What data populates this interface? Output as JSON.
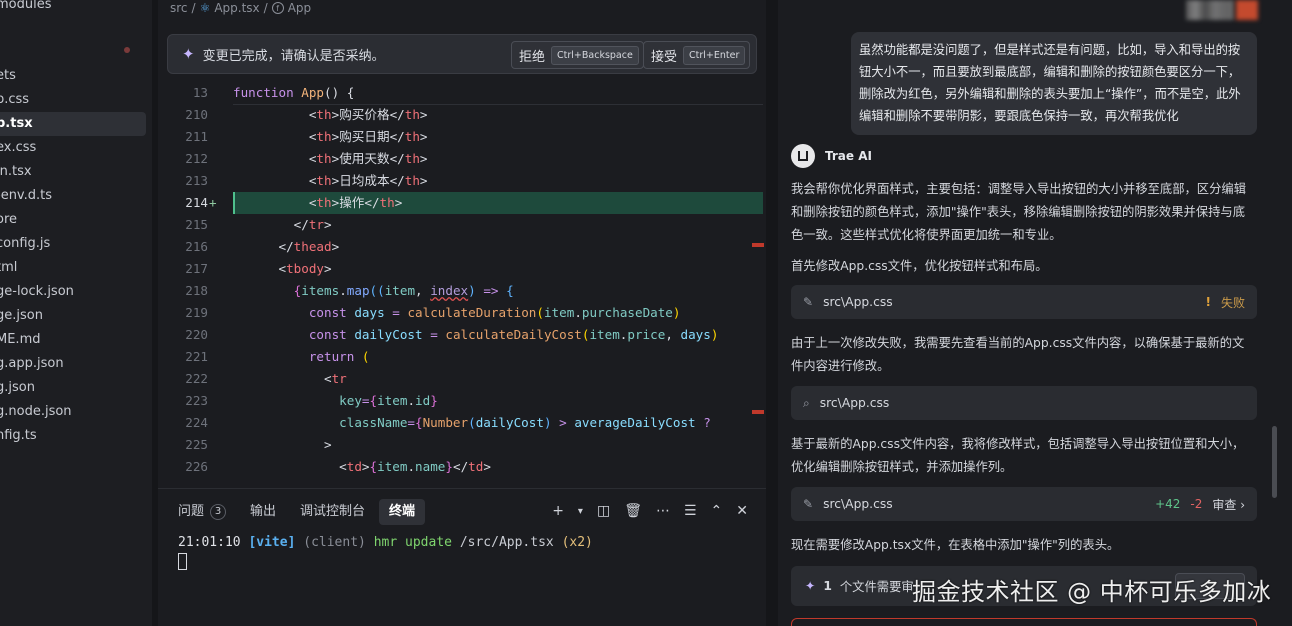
{
  "sidebar": {
    "items": [
      {
        "label": "modules",
        "active": false
      },
      {
        "label": "ets",
        "active": false
      },
      {
        "label": "p.css",
        "active": false
      },
      {
        "label": "p.tsx",
        "active": true
      },
      {
        "label": "ex.css",
        "active": false
      },
      {
        "label": "in.tsx",
        "active": false
      },
      {
        "label": "-env.d.ts",
        "active": false
      },
      {
        "label": "ore",
        "active": false
      },
      {
        "label": "config.js",
        "active": false
      },
      {
        "label": "tml",
        "active": false
      },
      {
        "label": "ge-lock.json",
        "active": false
      },
      {
        "label": "ge.json",
        "active": false
      },
      {
        "label": "ME.md",
        "active": false
      },
      {
        "label": "g.app.json",
        "active": false
      },
      {
        "label": "g.json",
        "active": false
      },
      {
        "label": "g.node.json",
        "active": false
      },
      {
        "label": "nfig.ts",
        "active": false
      }
    ]
  },
  "breadcrumb": {
    "folder": "src",
    "sep": "/",
    "file": "App.tsx",
    "symbol": "App"
  },
  "change_bar": {
    "message": "变更已完成，请确认是否采纳。",
    "reject_label": "拒绝",
    "reject_shortcut": "Ctrl+Backspace",
    "accept_label": "接受",
    "accept_shortcut": "Ctrl+Enter"
  },
  "code_lines": [
    {
      "ln": "13",
      "html": "<span class=\"c-kw\">function</span> <span class=\"c-fname\">App</span><span class=\"c-pun\">() {</span>"
    },
    {
      "ln": "210",
      "html": "          <span class=\"c-pun\">&lt;</span><span class=\"c-tag\">th</span><span class=\"c-pun\">&gt;</span><span class=\"c-txt\">购买价格</span><span class=\"c-pun\">&lt;/</span><span class=\"c-tag\">th</span><span class=\"c-pun\">&gt;</span>"
    },
    {
      "ln": "211",
      "html": "          <span class=\"c-pun\">&lt;</span><span class=\"c-tag\">th</span><span class=\"c-pun\">&gt;</span><span class=\"c-txt\">购买日期</span><span class=\"c-pun\">&lt;/</span><span class=\"c-tag\">th</span><span class=\"c-pun\">&gt;</span>"
    },
    {
      "ln": "212",
      "html": "          <span class=\"c-pun\">&lt;</span><span class=\"c-tag\">th</span><span class=\"c-pun\">&gt;</span><span class=\"c-txt\">使用天数</span><span class=\"c-pun\">&lt;/</span><span class=\"c-tag\">th</span><span class=\"c-pun\">&gt;</span>"
    },
    {
      "ln": "213",
      "html": "          <span class=\"c-pun\">&lt;</span><span class=\"c-tag\">th</span><span class=\"c-pun\">&gt;</span><span class=\"c-txt\">日均成本</span><span class=\"c-pun\">&lt;/</span><span class=\"c-tag\">th</span><span class=\"c-pun\">&gt;</span>"
    },
    {
      "ln": "214",
      "hl": true,
      "html": "          <span class=\"c-pun\">&lt;</span><span class=\"c-tag\">th</span><span class=\"c-pun\">&gt;</span><span class=\"c-txt\">操作</span><span class=\"c-pun\">&lt;/</span><span class=\"c-tag\">th</span><span class=\"c-pun\">&gt;</span>"
    },
    {
      "ln": "215",
      "html": "        <span class=\"c-pun\">&lt;/</span><span class=\"c-tag\">tr</span><span class=\"c-pun\">&gt;</span>"
    },
    {
      "ln": "216",
      "html": "      <span class=\"c-pun\">&lt;/</span><span class=\"c-tag\">thead</span><span class=\"c-pun\">&gt;</span>"
    },
    {
      "ln": "217",
      "html": "      <span class=\"c-pun\">&lt;</span><span class=\"c-tag\">tbody</span><span class=\"c-pun\">&gt;</span>"
    },
    {
      "ln": "218",
      "html": "        <span class=\"c-br2\">{</span><span class=\"c-id\">items</span><span class=\"c-pun\">.</span><span class=\"c-fn\">map</span><span class=\"c-br3\">((</span><span class=\"c-id\">item</span><span class=\"c-pun\">, </span><span class=\"c-prm squig\">index</span><span class=\"c-br3\">)</span> <span class=\"c-kw\">=&gt;</span> <span class=\"c-br3\">{</span>"
    },
    {
      "ln": "219",
      "html": "          <span class=\"c-kw\">const</span> <span class=\"c-var\">days</span> <span class=\"c-kw\">=</span> <span class=\"c-call\">calculateDuration</span><span class=\"c-br\">(</span><span class=\"c-id\">item</span><span class=\"c-pun\">.</span><span class=\"c-id\">purchaseDate</span><span class=\"c-br\">)</span>"
    },
    {
      "ln": "220",
      "html": "          <span class=\"c-kw\">const</span> <span class=\"c-var\">dailyCost</span> <span class=\"c-kw\">=</span> <span class=\"c-call\">calculateDailyCost</span><span class=\"c-br\">(</span><span class=\"c-id\">item</span><span class=\"c-pun\">.</span><span class=\"c-id\">price</span><span class=\"c-pun\">, </span><span class=\"c-var\">days</span><span class=\"c-br\">)</span>"
    },
    {
      "ln": "221",
      "html": "          <span class=\"c-kw\">return</span> <span class=\"c-br\">(</span>"
    },
    {
      "ln": "222",
      "html": "            <span class=\"c-pun\">&lt;</span><span class=\"c-tag\">tr</span>"
    },
    {
      "ln": "223",
      "html": "              <span class=\"c-id\">key</span><span class=\"c-kw\">=</span><span class=\"c-br2\">{</span><span class=\"c-id\">item</span><span class=\"c-pun\">.</span><span class=\"c-id\">id</span><span class=\"c-br2\">}</span>"
    },
    {
      "ln": "224",
      "html": "              <span class=\"c-id\">className</span><span class=\"c-kw\">=</span><span class=\"c-br2\">{</span><span class=\"c-call\">Number</span><span class=\"c-br3\">(</span><span class=\"c-var\">dailyCost</span><span class=\"c-br3\">)</span> <span class=\"c-kw\">&gt;</span> <span class=\"c-var\">averageDailyCost</span> <span class=\"c-kw\">?</span>"
    },
    {
      "ln": "225",
      "html": "            <span class=\"c-pun\">&gt;</span>"
    },
    {
      "ln": "226",
      "html": "              <span class=\"c-pun\">&lt;</span><span class=\"c-tag\">td</span><span class=\"c-pun\">&gt;</span><span class=\"c-br2\">{</span><span class=\"c-id\">item</span><span class=\"c-pun\">.</span><span class=\"c-id\">name</span><span class=\"c-br2\">}</span><span class=\"c-pun\">&lt;/</span><span class=\"c-tag\">td</span><span class=\"c-pun\">&gt;</span>"
    }
  ],
  "panel": {
    "tabs": [
      {
        "label": "问题",
        "badge": "3",
        "active": false
      },
      {
        "label": "输出",
        "active": false
      },
      {
        "label": "调试控制台",
        "active": false
      },
      {
        "label": "终端",
        "active": true
      }
    ],
    "terminal": {
      "time": "21:01:10",
      "tag": "[vite]",
      "client": "(client)",
      "hmr": "hmr update",
      "path": "/src/App.tsx",
      "count": "(x2)"
    }
  },
  "chat": {
    "user_message": "虽然功能都是没问题了，但是样式还是有问题，比如，导入和导出的按钮大小不一，而且要放到最底部，编辑和删除的按钮颜色要区分一下，删除改为红色，另外编辑和删除的表头要加上“操作”，而不是空，此外编辑和删除不要带阴影，要跟底色保持一致，再次帮我优化",
    "ai_name": "Trae AI",
    "p1": "我会帮你优化界面样式，主要包括：调整导入导出按钮的大小并移至底部，区分编辑和删除按钮的颜色样式，添加\"操作\"表头，移除编辑删除按钮的阴影效果并保持与底色一致。这些样式优化将使界面更加统一和专业。",
    "p2": "首先修改App.css文件，优化按钮样式和布局。",
    "card1": {
      "file": "src\\App.css",
      "status": "失败"
    },
    "p3": "由于上一次修改失败，我需要先查看当前的App.css文件内容，以确保基于最新的文件内容进行修改。",
    "card2": {
      "file": "src\\App.css"
    },
    "p4": "基于最新的App.css文件内容，我将修改样式，包括调整导入导出按钮位置和大小，优化编辑删除按钮样式，并添加操作列。",
    "card3": {
      "file": "src\\App.css",
      "added": "+42",
      "removed": "-2",
      "review": "审查"
    },
    "p5": "现在需要修改App.tsx文件，在表格中添加\"操作\"列的表头。",
    "pending": {
      "count": "1",
      "label": "个文件需要审"
    },
    "watermark": "掘金技术社区 @ 中杯可乐多加冰"
  }
}
